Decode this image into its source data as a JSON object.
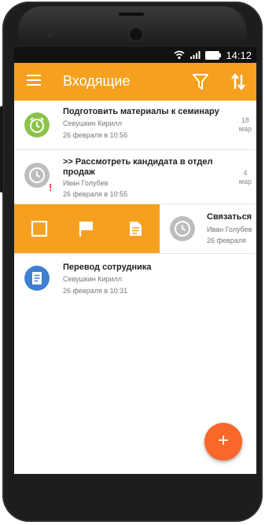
{
  "status_bar": {
    "time": "14:12"
  },
  "app_bar": {
    "title": "Входящие"
  },
  "tasks": [
    {
      "title": "Подготовить материалы к семинару",
      "person": "Севушкин Кирилл",
      "date": "26 февраля в 10:56",
      "ago_num": "18",
      "ago_unit": "мар",
      "status_color": "#8bc34a",
      "icon": "alarm-clock-icon"
    },
    {
      "title_line1": ">> Рассмотреть кандидата в отдел",
      "title_line2": "продаж",
      "person": "Иван Голубев",
      "date": "26 февраля в 10:55",
      "ago_num": "4",
      "ago_unit": "мар",
      "status_color": "#bdbdbd",
      "icon": "clock-icon",
      "warning": "!"
    },
    {
      "title": "Связаться",
      "person": "Иван Голубев",
      "date": "26 февраля",
      "status_color": "#bdbdbd",
      "icon": "clock-icon"
    },
    {
      "title": "Перевод сотрудника",
      "person": "Севушкин Кирилл",
      "date": "26 февраля в 10:31",
      "status_color": "#3f7fd1",
      "icon": "document-icon"
    }
  ],
  "swipe_actions": [
    "checkbox-icon",
    "flag-icon",
    "note-icon"
  ],
  "fab": {
    "label": "+"
  },
  "colors": {
    "accent": "#f5a11f",
    "fab": "#f9672a",
    "warning": "#e53935"
  }
}
